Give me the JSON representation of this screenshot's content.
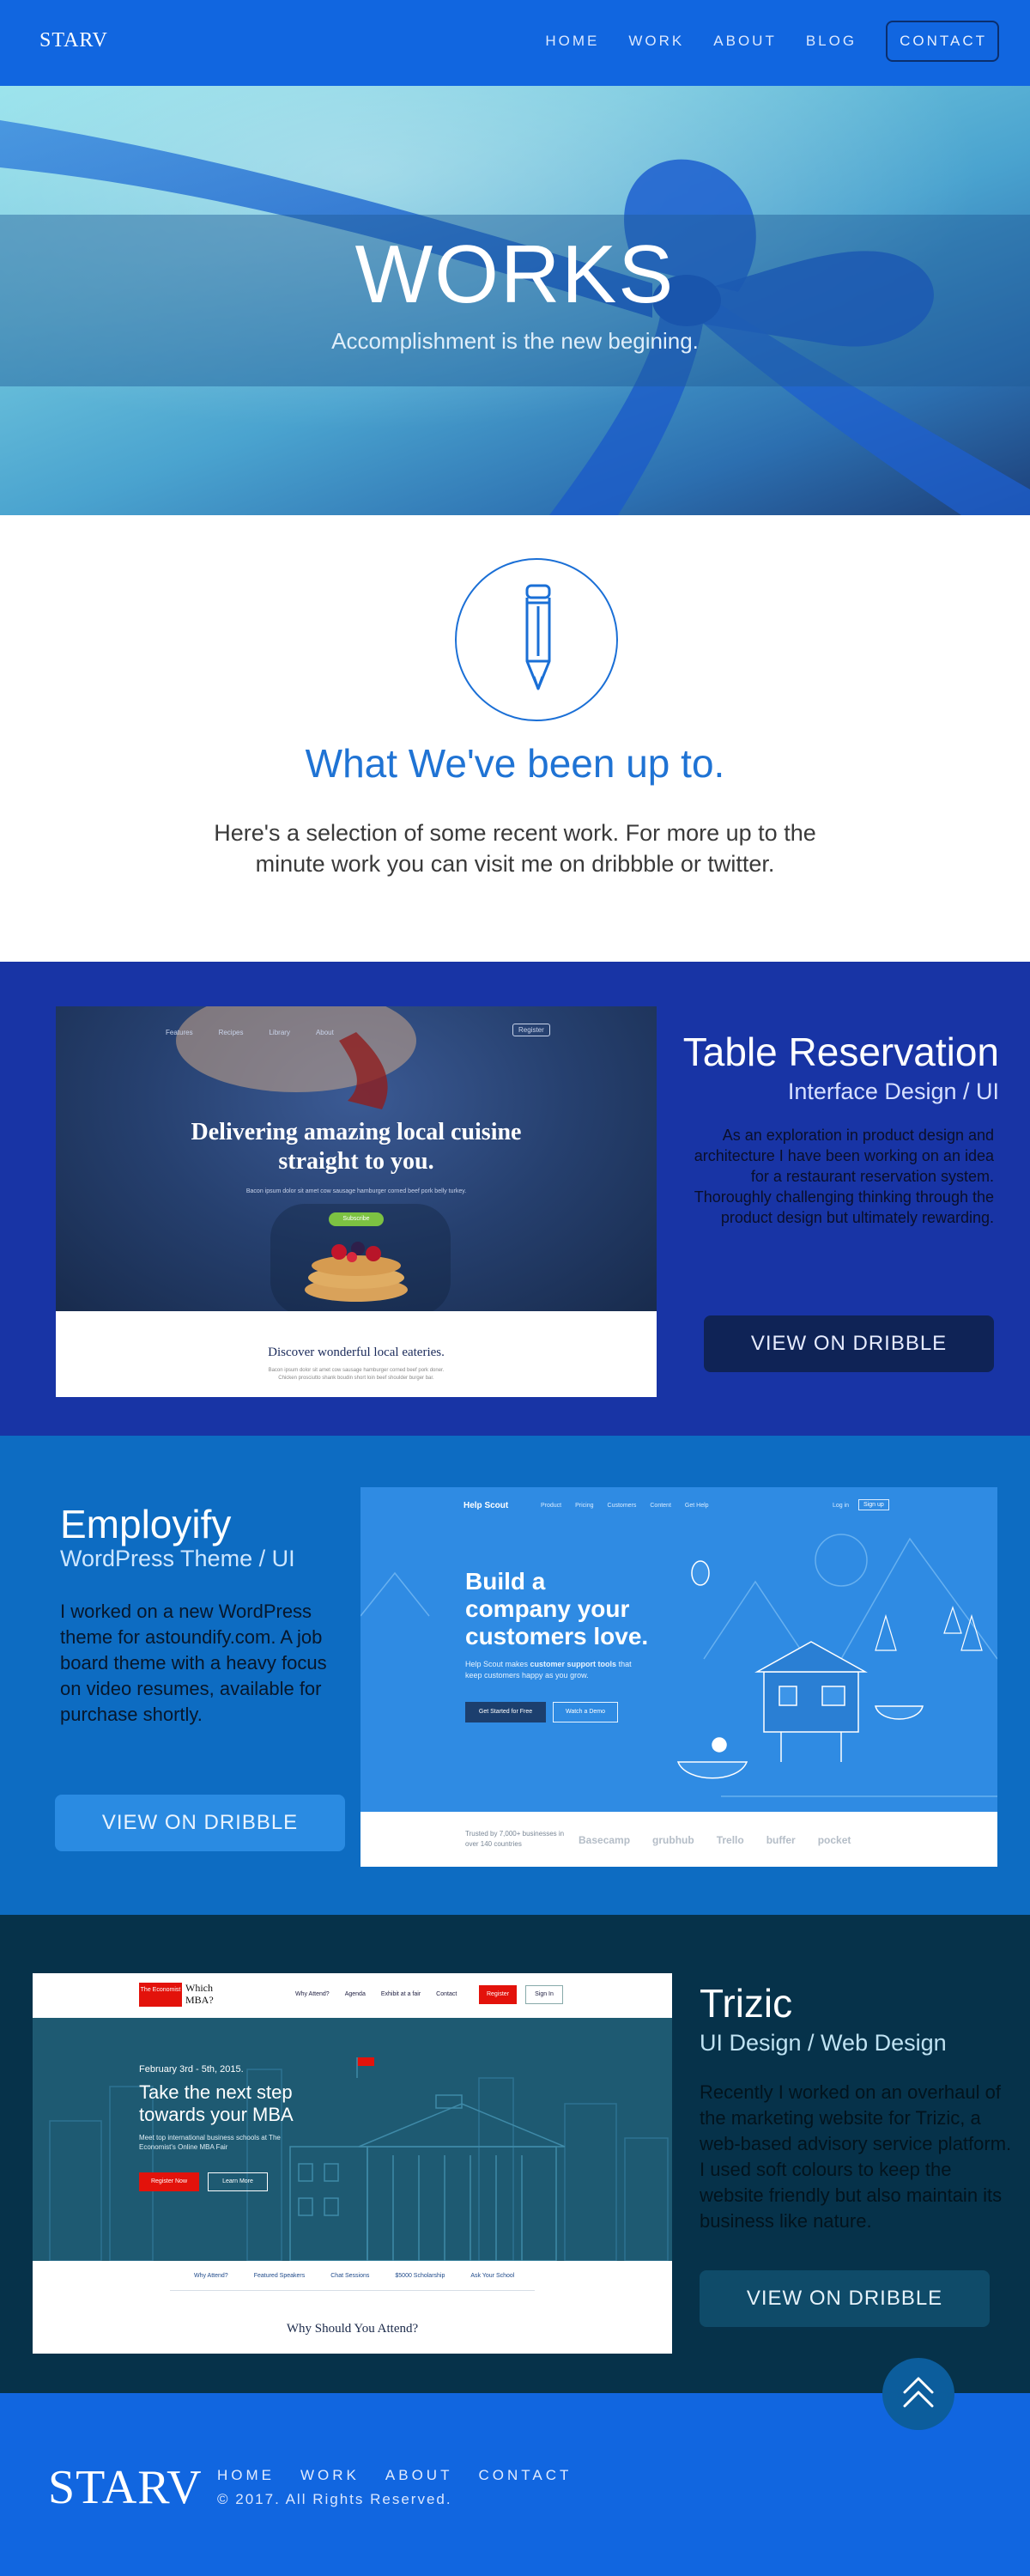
{
  "nav": {
    "logo": "STARV",
    "links": [
      "HOME",
      "WORK",
      "ABOUT",
      "BLOG"
    ],
    "cta": "CONTACT"
  },
  "hero": {
    "title": "WORKS",
    "subtitle": "Accomplishment is the new begining."
  },
  "intro": {
    "icon": "pencil-icon",
    "title": "What We've been up to.",
    "text": "Here's a selection of some recent work. For more up to the minute work you can visit me on dribbble or twitter."
  },
  "projects": [
    {
      "title": "Table Reservation",
      "subtitle": "Interface Design / UI",
      "description": "As an exploration in product design and architecture I have been working on an idea for a restaurant reservation system. Thoroughly challenging thinking through the product design but ultimately rewarding.",
      "button": "VIEW ON DRIBBLE",
      "screenshot": {
        "nav_items": [
          "Features",
          "Recipes",
          "Library",
          "About",
          "Register"
        ],
        "hero_title": "Delivering amazing local cuisine straight to you.",
        "hero_text": "Bacon ipsum dolor sit amet cow sausage hamburger corned beef pork belly turkey.",
        "hero_button": "Subscribe",
        "section_title": "Discover wonderful local eateries.",
        "section_text": "Bacon ipsum dolor sit amet cow sausage hamburger corned beef pork doner. Chicken prosciutto shank boudin short loin beef shoulder burger bar."
      }
    },
    {
      "title": "Employify",
      "subtitle": "WordPress Theme / UI",
      "description": "I worked on a new WordPress theme for astoundify.com. A job board theme with a heavy focus on video resumes, available for purchase shortly.",
      "button": "VIEW ON DRIBBLE",
      "screenshot": {
        "brand": "Help Scout",
        "nav_items": [
          "Product",
          "Pricing",
          "Customers",
          "Content",
          "Get Help"
        ],
        "login": "Log in",
        "signup": "Sign up",
        "hero_title": "Build a company your customers love.",
        "hero_text_pre": "Help Scout makes ",
        "hero_text_bold": "customer support tools",
        "hero_text_post": " that keep customers happy as you grow.",
        "btn_primary": "Get Started for Free",
        "btn_secondary": "Watch a Demo",
        "trusted": "Trusted by 7,000+ businesses in over 140 countries",
        "logos": [
          "Basecamp",
          "grubhub",
          "Trello",
          "buffer",
          "pocket"
        ]
      }
    },
    {
      "title": "Trizic",
      "subtitle": "UI Design / Web Design",
      "description": "Recently I worked on an overhaul of the marketing website for Trizic, a web-based advisory service platform. I used soft colours to keep the website friendly but also maintain its business like nature.",
      "button": "VIEW ON DRIBBLE",
      "screenshot": {
        "brand_box": "The Economist",
        "brand_text": "Which MBA?",
        "nav_items": [
          "Why Attend?",
          "Agenda",
          "Exhibit at a fair",
          "Contact"
        ],
        "register": "Register",
        "signin": "Sign In",
        "date": "February 3rd - 5th, 2015.",
        "hero_title": "Take the next step towards your MBA",
        "hero_text": "Meet top international business schools at The Economist's Online MBA Fair",
        "btn_register": "Register Now",
        "btn_learn": "Learn More",
        "subnav": [
          "Why Attend?",
          "Featured Speakers",
          "Chat Sessions",
          "$5000 Scholarship",
          "Ask Your School"
        ],
        "section_title": "Why Should You Attend?"
      }
    }
  ],
  "back_to_top_icon": "double-chevron-up-icon",
  "footer": {
    "logo": "STARV",
    "links": [
      "HOME",
      "WORK",
      "ABOUT",
      "CONTACT"
    ],
    "copyright": "© 2017. All Rights Reserved."
  }
}
